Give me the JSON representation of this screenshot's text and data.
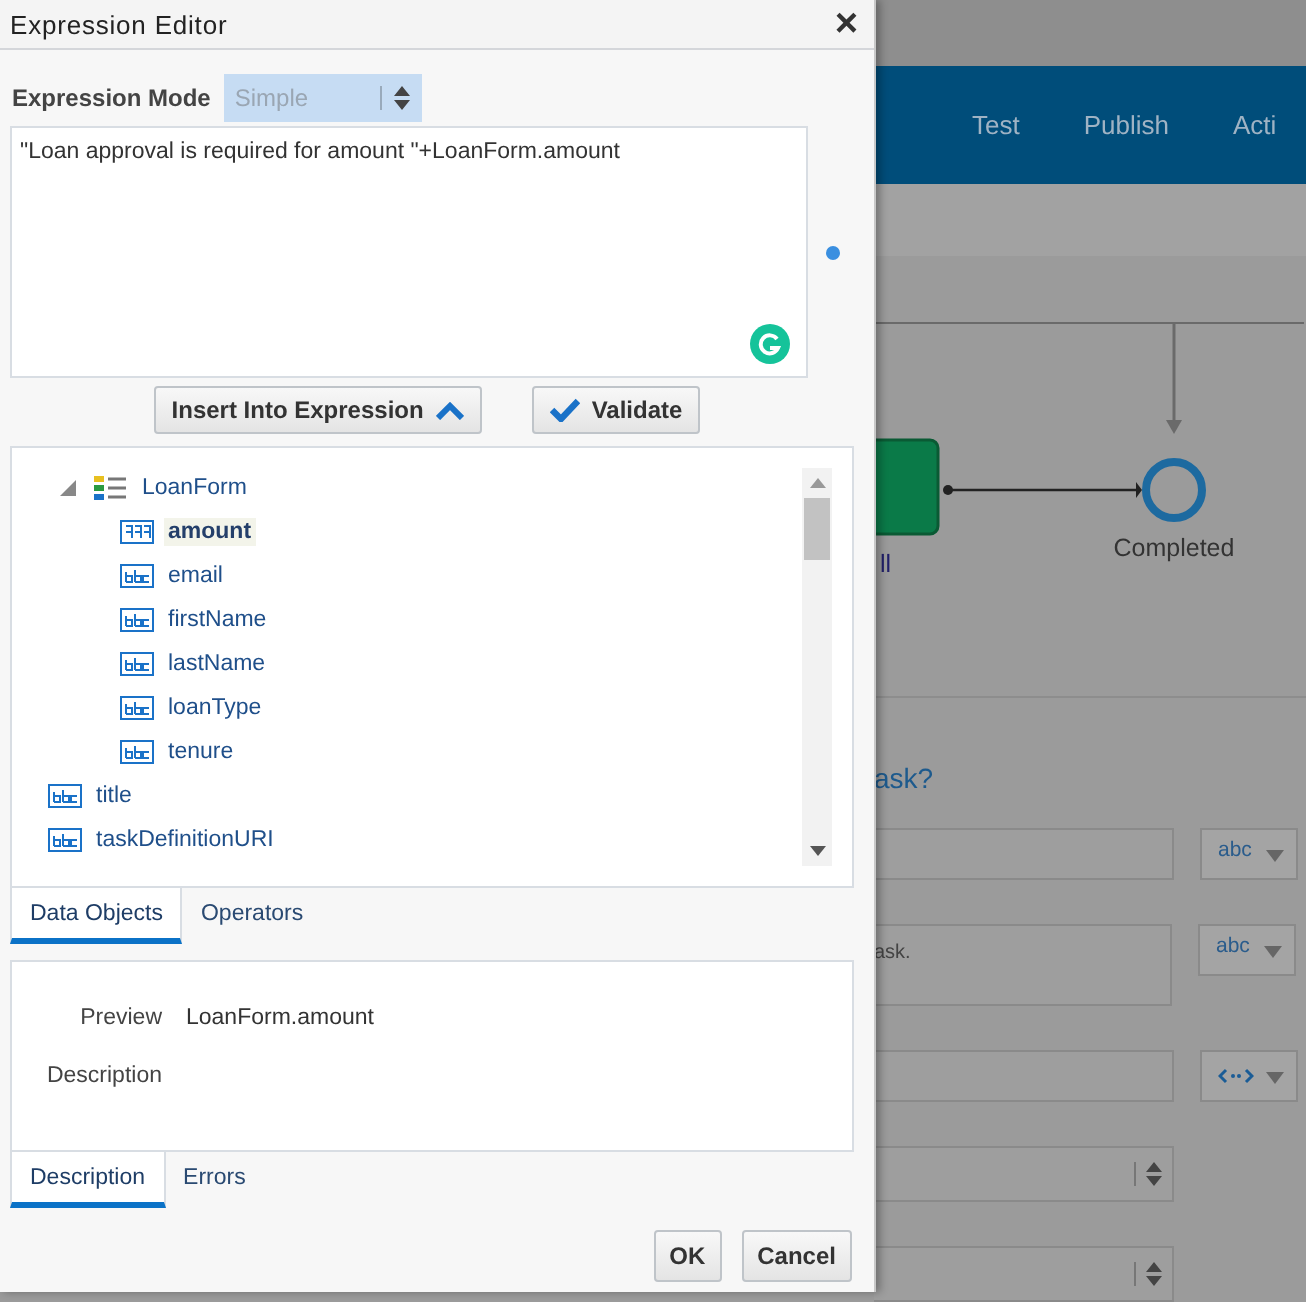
{
  "dialog": {
    "title": "Expression Editor",
    "close": "×",
    "mode": {
      "label": "Expression Mode",
      "value": "Simple",
      "disabled": true
    },
    "expression": "\"Loan approval is required for amount \"+LoanForm.amount",
    "insert_button": "Insert Into Expression",
    "validate_button": "Validate",
    "tree": [
      {
        "label": "LoanForm",
        "kind": "object",
        "expanded": true,
        "selected": false,
        "children": [
          {
            "label": "amount",
            "kind": "number",
            "selected": true
          },
          {
            "label": "email",
            "kind": "text",
            "selected": false
          },
          {
            "label": "firstName",
            "kind": "text",
            "selected": false
          },
          {
            "label": "lastName",
            "kind": "text",
            "selected": false
          },
          {
            "label": "loanType",
            "kind": "text",
            "selected": false
          },
          {
            "label": "tenure",
            "kind": "text",
            "selected": false
          }
        ]
      },
      {
        "label": "title",
        "kind": "text",
        "selected": false
      },
      {
        "label": "taskDefinitionURI",
        "kind": "text",
        "selected": false
      }
    ],
    "tabs": [
      {
        "label": "Data Objects",
        "selected": true
      },
      {
        "label": "Operators",
        "selected": false
      }
    ],
    "preview": {
      "label": "Preview",
      "value": "LoanForm.amount"
    },
    "description": {
      "label": "Description"
    },
    "detail_tabs": [
      {
        "label": "Description",
        "selected": true
      },
      {
        "label": "Errors",
        "selected": false
      }
    ],
    "buttons": [
      "OK",
      "Cancel"
    ]
  },
  "background": {
    "nav": [
      "Test",
      "Publish",
      "Acti"
    ],
    "diagram": {
      "end_label": "Completed",
      "task_label": "ll"
    },
    "form": {
      "question": "ask?",
      "fields": [
        {
          "kind": "text",
          "type": {
            "kind": "label",
            "label": "abc"
          }
        },
        {
          "kind": "textarea",
          "value": "ask.",
          "type": {
            "kind": "label",
            "label": "abc"
          }
        },
        {
          "kind": "text",
          "type": {
            "kind": "icon"
          }
        },
        {
          "kind": "select"
        },
        {
          "kind": "select"
        }
      ]
    }
  }
}
